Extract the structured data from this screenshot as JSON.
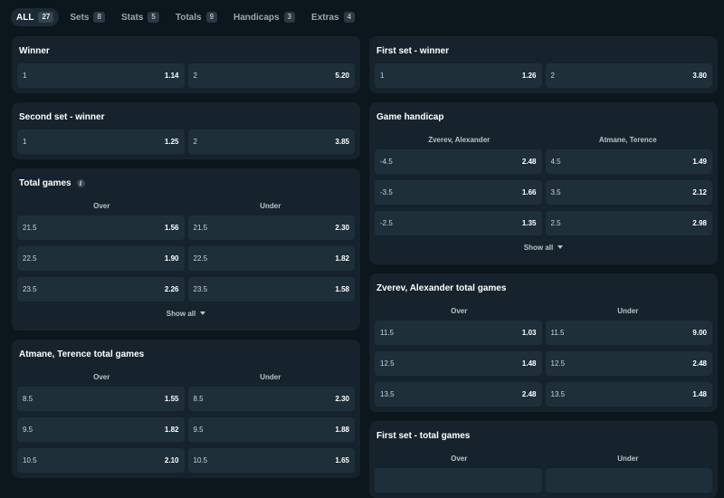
{
  "tabs": [
    {
      "label": "ALL",
      "count": "27"
    },
    {
      "label": "Sets",
      "count": "8"
    },
    {
      "label": "Stats",
      "count": "5"
    },
    {
      "label": "Totals",
      "count": "9"
    },
    {
      "label": "Handicaps",
      "count": "3"
    },
    {
      "label": "Extras",
      "count": "4"
    }
  ],
  "winner": {
    "title": "Winner",
    "rows": [
      [
        {
          "l": "1",
          "v": "1.14"
        },
        {
          "l": "2",
          "v": "5.20"
        }
      ]
    ]
  },
  "second_set": {
    "title": "Second set - winner",
    "rows": [
      [
        {
          "l": "1",
          "v": "1.25"
        },
        {
          "l": "2",
          "v": "3.85"
        }
      ]
    ]
  },
  "total_games": {
    "title": "Total games",
    "info_icon": "i",
    "headers": [
      "Over",
      "Under"
    ],
    "rows": [
      [
        {
          "l": "21.5",
          "v": "1.56"
        },
        {
          "l": "21.5",
          "v": "2.30"
        }
      ],
      [
        {
          "l": "22.5",
          "v": "1.90"
        },
        {
          "l": "22.5",
          "v": "1.82"
        }
      ],
      [
        {
          "l": "23.5",
          "v": "2.26"
        },
        {
          "l": "23.5",
          "v": "1.58"
        }
      ]
    ],
    "show_all": "Show all"
  },
  "atmane_total": {
    "title": "Atmane, Terence total games",
    "headers": [
      "Over",
      "Under"
    ],
    "rows": [
      [
        {
          "l": "8.5",
          "v": "1.55"
        },
        {
          "l": "8.5",
          "v": "2.30"
        }
      ],
      [
        {
          "l": "9.5",
          "v": "1.82"
        },
        {
          "l": "9.5",
          "v": "1.88"
        }
      ],
      [
        {
          "l": "10.5",
          "v": "2.10"
        },
        {
          "l": "10.5",
          "v": "1.65"
        }
      ]
    ]
  },
  "first_set": {
    "title": "First set - winner",
    "rows": [
      [
        {
          "l": "1",
          "v": "1.26"
        },
        {
          "l": "2",
          "v": "3.80"
        }
      ]
    ]
  },
  "game_handicap": {
    "title": "Game handicap",
    "headers": [
      "Zverev, Alexander",
      "Atmane, Terence"
    ],
    "rows": [
      [
        {
          "l": "-4.5",
          "v": "2.48"
        },
        {
          "l": "4.5",
          "v": "1.49"
        }
      ],
      [
        {
          "l": "-3.5",
          "v": "1.66"
        },
        {
          "l": "3.5",
          "v": "2.12"
        }
      ],
      [
        {
          "l": "-2.5",
          "v": "1.35"
        },
        {
          "l": "2.5",
          "v": "2.98"
        }
      ]
    ],
    "show_all": "Show all"
  },
  "zverev_total": {
    "title": "Zverev, Alexander total games",
    "headers": [
      "Over",
      "Under"
    ],
    "rows": [
      [
        {
          "l": "11.5",
          "v": "1.03"
        },
        {
          "l": "11.5",
          "v": "9.00"
        }
      ],
      [
        {
          "l": "12.5",
          "v": "1.48"
        },
        {
          "l": "12.5",
          "v": "2.48"
        }
      ],
      [
        {
          "l": "13.5",
          "v": "2.48"
        },
        {
          "l": "13.5",
          "v": "1.48"
        }
      ]
    ]
  },
  "first_set_total": {
    "title": "First set - total games",
    "headers": [
      "Over",
      "Under"
    ]
  }
}
